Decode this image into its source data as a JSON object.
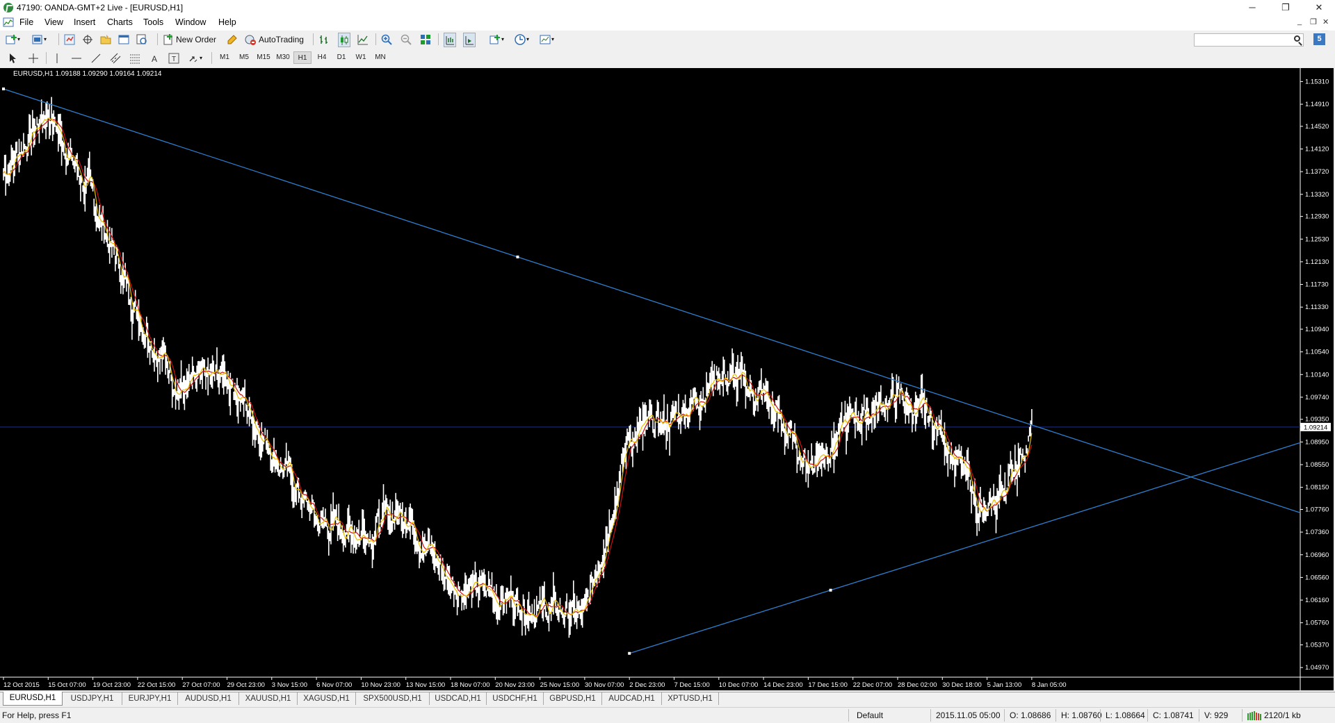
{
  "window": {
    "title": "47190: OANDA-GMT+2 Live - [EURUSD,H1]",
    "minimize": "─",
    "restore": "❐",
    "close": "✕"
  },
  "menu": {
    "items": [
      "File",
      "View",
      "Insert",
      "Charts",
      "Tools",
      "Window",
      "Help"
    ],
    "mdi_minimize": "_",
    "mdi_restore": "❐",
    "mdi_close": "✕"
  },
  "toolbar": {
    "new_order": "New Order",
    "autotrading": "AutoTrading",
    "timeframes": [
      "M1",
      "M5",
      "M15",
      "M30",
      "H1",
      "H4",
      "D1",
      "W1",
      "MN"
    ],
    "active_timeframe": "H1"
  },
  "chart": {
    "info": "EURUSD,H1  1.09188 1.09290 1.09164 1.09214",
    "symbol": "EURUSD",
    "timeframe": "H1",
    "open": 1.09188,
    "high": 1.0929,
    "low": 1.09164,
    "close": 1.09214,
    "current_price_label": "1.09214",
    "colors": {
      "background": "#000000",
      "price_line": "#ffffff",
      "ma_fast": "#e8c000",
      "ma_slow": "#d01010",
      "trendline": "#2f7fcf",
      "bid_line": "#1e2f8c"
    },
    "price_axis_labels": [
      "1.15310",
      "1.14910",
      "1.14520",
      "1.14120",
      "1.13720",
      "1.13320",
      "1.12930",
      "1.12530",
      "1.12130",
      "1.11730",
      "1.11330",
      "1.10940",
      "1.10540",
      "1.10140",
      "1.09740",
      "1.09350",
      "1.08950",
      "1.08550",
      "1.08150",
      "1.07760",
      "1.07360",
      "1.06960",
      "1.06560",
      "1.06160",
      "1.05760",
      "1.05370",
      "1.04970"
    ],
    "time_axis_labels": [
      "12 Oct 2015",
      "15 Oct 07:00",
      "19 Oct 23:00",
      "22 Oct 15:00",
      "27 Oct 07:00",
      "29 Oct 23:00",
      "3 Nov 15:00",
      "6 Nov 07:00",
      "10 Nov 23:00",
      "13 Nov 15:00",
      "18 Nov 07:00",
      "20 Nov 23:00",
      "25 Nov 15:00",
      "30 Nov 07:00",
      "2 Dec 23:00",
      "7 Dec 15:00",
      "10 Dec 07:00",
      "14 Dec 23:00",
      "17 Dec 15:00",
      "22 Dec 07:00",
      "28 Dec 02:00",
      "30 Dec 18:00",
      "5 Jan 13:00",
      "8 Jan 05:00"
    ]
  },
  "chart_data": {
    "type": "line",
    "title": "EURUSD,H1",
    "xlabel": "",
    "ylabel": "",
    "ylim": [
      1.0497,
      1.1531
    ],
    "x": [
      "12 Oct 2015",
      "15 Oct 07:00",
      "19 Oct 23:00",
      "22 Oct 15:00",
      "27 Oct 07:00",
      "29 Oct 23:00",
      "3 Nov 15:00",
      "6 Nov 07:00",
      "10 Nov 23:00",
      "13 Nov 15:00",
      "18 Nov 07:00",
      "20 Nov 23:00",
      "25 Nov 15:00",
      "30 Nov 07:00",
      "2 Dec 23:00",
      "7 Dec 15:00",
      "10 Dec 07:00",
      "14 Dec 23:00",
      "17 Dec 15:00",
      "22 Dec 07:00",
      "28 Dec 02:00",
      "30 Dec 18:00",
      "5 Jan 13:00",
      "8 Jan 05:00"
    ],
    "series": [
      {
        "values": [
          1.137,
          1.148,
          1.132,
          1.1125,
          1.0985,
          1.1015,
          1.0885,
          1.0755,
          1.0735,
          1.0775,
          1.0645,
          1.0625,
          1.0605,
          1.0585,
          1.0905,
          1.0935,
          1.1015,
          1.0975,
          1.0855,
          1.0935,
          1.0975,
          1.0915,
          1.0755,
          1.0915
        ]
      }
    ],
    "trendlines": [
      {
        "from": [
          "12 Oct 2015",
          1.1518
        ],
        "to": [
          "8 Jan 05:00",
          1.0925
        ]
      },
      {
        "from": [
          "2 Dec 23:00",
          1.0522
        ],
        "to": [
          "8 Jan 05:00",
          1.0745
        ]
      }
    ],
    "horizontal_line": 1.09214
  },
  "tabs": [
    "EURUSD,H1",
    "USDJPY,H1",
    "EURJPY,H1",
    "AUDUSD,H1",
    "XAUUSD,H1",
    "XAGUSD,H1",
    "SPX500USD,H1",
    "USDCAD,H1",
    "USDCHF,H1",
    "GBPUSD,H1",
    "AUDCAD,H1",
    "XPTUSD,H1"
  ],
  "status": {
    "help": "For Help, press F1",
    "profile": "Default",
    "datetime": "2015.11.05 05:00",
    "open": "O: 1.08686",
    "high": "H: 1.08760",
    "low": "L: 1.08664",
    "close": "C: 1.08741",
    "volume": "V: 929",
    "traffic": "2120/1 kb"
  }
}
